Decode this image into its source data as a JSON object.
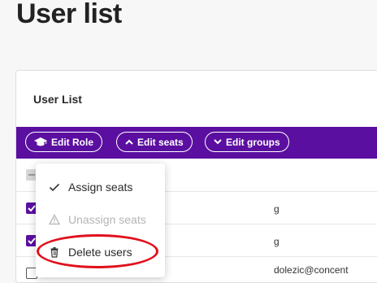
{
  "page": {
    "title": "User list"
  },
  "card": {
    "title": "User List"
  },
  "toolbar": {
    "edit_role_label": "Edit Role",
    "edit_seats_label": "Edit seats",
    "edit_groups_label": "Edit groups"
  },
  "rows": [
    {
      "text": "g"
    },
    {
      "text": "g"
    },
    {
      "text": "dolezic@concent"
    }
  ],
  "dropdown": {
    "items": [
      {
        "label": "Assign seats",
        "icon": "check-icon",
        "enabled": true
      },
      {
        "label": "Unassign seats",
        "icon": "warning-icon",
        "enabled": false
      },
      {
        "label": "Delete users",
        "icon": "trash-icon",
        "enabled": true
      }
    ]
  },
  "colors": {
    "accent": "#5b0fa0",
    "highlight": "#e0101c"
  }
}
